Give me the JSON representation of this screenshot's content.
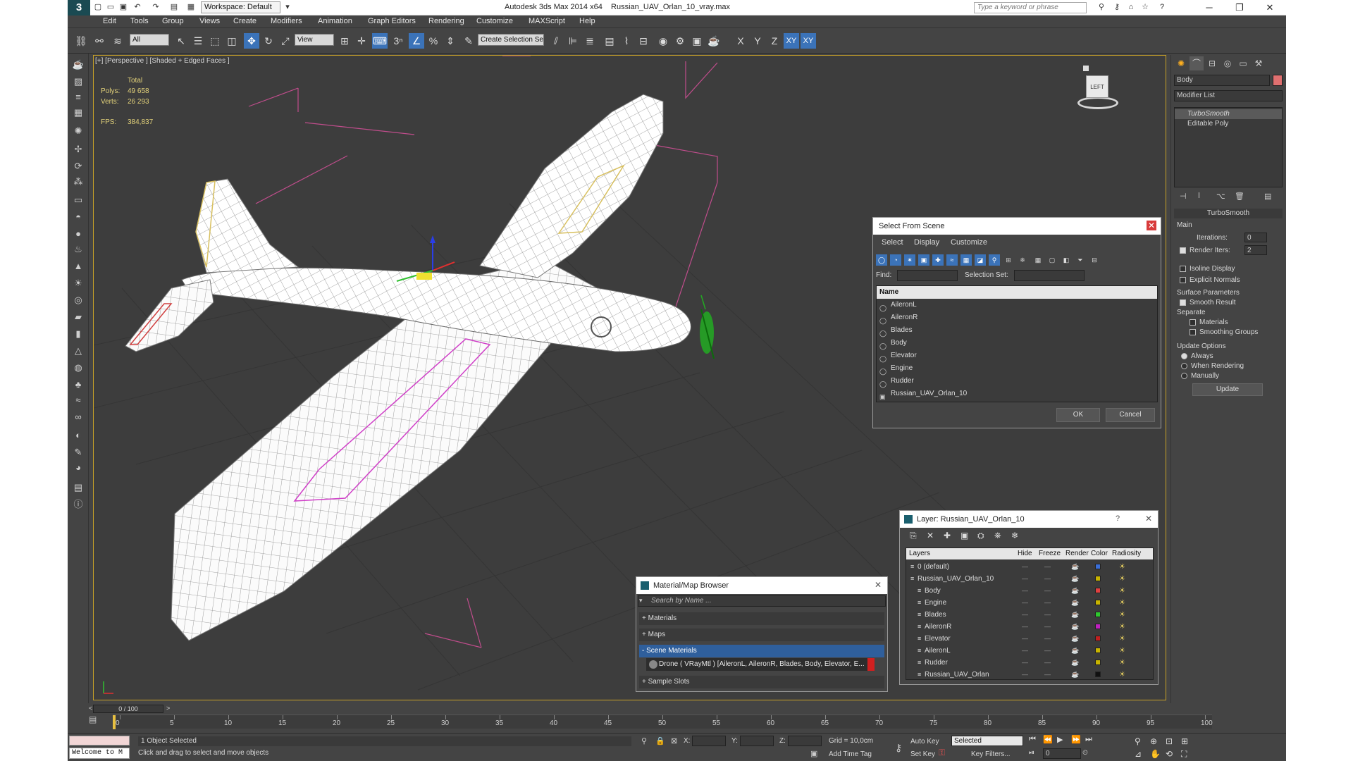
{
  "titlebar": {
    "app_title": "Autodesk 3ds Max  2014 x64",
    "file_name": "Russian_UAV_Orlan_10_vray.max",
    "workspace": "Workspace: Default",
    "search_placeholder": "Type a keyword or phrase",
    "logo": "3"
  },
  "menu": [
    "Edit",
    "Tools",
    "Group",
    "Views",
    "Create",
    "Modifiers",
    "Animation",
    "Graph Editors",
    "Rendering",
    "Customize",
    "MAXScript",
    "Help"
  ],
  "toolbar": {
    "selection_filter": "All",
    "ref_coord": "View",
    "named_selection": "Create Selection Se",
    "snap_value": "3"
  },
  "viewport": {
    "label": "[+] [Perspective ] [Shaded + Edged Faces ]",
    "stats_total": "Total",
    "polys_label": "Polys:",
    "polys_value": "49 658",
    "verts_label": "Verts:",
    "verts_value": "26 293",
    "fps_label": "FPS:",
    "fps_value": "384,837"
  },
  "select_from_scene": {
    "title": "Select From Scene",
    "menus": [
      "Select",
      "Display",
      "Customize"
    ],
    "find_label": "Find:",
    "selection_set_label": "Selection Set:",
    "name_header": "Name",
    "items": [
      "AileronL",
      "AileronR",
      "Blades",
      "Body",
      "Elevator",
      "Engine",
      "Rudder",
      "Russian_UAV_Orlan_10"
    ],
    "ok": "OK",
    "cancel": "Cancel"
  },
  "layer_dialog": {
    "title": "Layer: Russian_UAV_Orlan_10",
    "help": "?",
    "columns": [
      "Layers",
      "Hide",
      "Freeze",
      "Render",
      "Color",
      "Radiosity"
    ],
    "rows": [
      {
        "name": "0 (default)",
        "color": "#3a6ed8",
        "indent": 0
      },
      {
        "name": "Russian_UAV_Orlan_10",
        "color": "#c8b400",
        "indent": 0
      },
      {
        "name": "Body",
        "color": "#e04040",
        "indent": 1
      },
      {
        "name": "Engine",
        "color": "#c8b400",
        "indent": 1
      },
      {
        "name": "Blades",
        "color": "#2ec82e",
        "indent": 1
      },
      {
        "name": "AileronR",
        "color": "#c020c0",
        "indent": 1
      },
      {
        "name": "Elevator",
        "color": "#c02020",
        "indent": 1
      },
      {
        "name": "AileronL",
        "color": "#c8b400",
        "indent": 1
      },
      {
        "name": "Rudder",
        "color": "#c8b400",
        "indent": 1
      },
      {
        "name": "Russian_UAV_Orlan",
        "color": "#111111",
        "indent": 1
      }
    ]
  },
  "material_browser": {
    "title": "Material/Map Browser",
    "search_placeholder": "Search by Name ...",
    "sections": [
      "+ Materials",
      "+ Maps",
      "- Scene Materials"
    ],
    "scene_material": "Drone  ( VRayMtl ) [AileronL, AileronR, Blades, Body, Elevator, E...",
    "sample_slots": "+ Sample Slots"
  },
  "command_panel": {
    "object_name": "Body",
    "modifier_list": "Modifier List",
    "stack": [
      "TurboSmooth",
      "Editable Poly"
    ],
    "rollout_title": "TurboSmooth",
    "main_label": "Main",
    "iterations_label": "Iterations:",
    "iterations_value": "0",
    "render_iters_label": "Render Iters:",
    "render_iters_value": "2",
    "isoline": "Isoline Display",
    "explicit_normals": "Explicit Normals",
    "surface_params": "Surface Parameters",
    "smooth_result": "Smooth Result",
    "separate": "Separate",
    "materials": "Materials",
    "smoothing_groups": "Smoothing Groups",
    "update_options": "Update Options",
    "always": "Always",
    "when_rendering": "When Rendering",
    "manually": "Manually",
    "update_btn": "Update"
  },
  "viewcube_label": "LEFT",
  "timeline": {
    "frame_counter": "0 / 100",
    "ticks": [
      "0",
      "5",
      "10",
      "15",
      "20",
      "25",
      "30",
      "35",
      "40",
      "45",
      "50",
      "55",
      "60",
      "65",
      "70",
      "75",
      "80",
      "85",
      "90",
      "95",
      "100"
    ]
  },
  "status": {
    "selected": "1 Object Selected",
    "prompt": "Click and drag to select and move objects",
    "welcome": "Welcome to M",
    "x_label": "X:",
    "y_label": "Y:",
    "z_label": "Z:",
    "grid": "Grid = 10,0cm",
    "auto_key": "Auto Key",
    "set_key": "Set Key",
    "selected_dropdown": "Selected",
    "add_time_tag": "Add Time Tag",
    "key_filters": "Key Filters...",
    "frame_value": "0"
  },
  "colors": {
    "accent": "#3b73b9",
    "viewport_bg": "#3d3d3d",
    "ui_bg": "#444444",
    "selection_yellow": "#c9a227"
  }
}
